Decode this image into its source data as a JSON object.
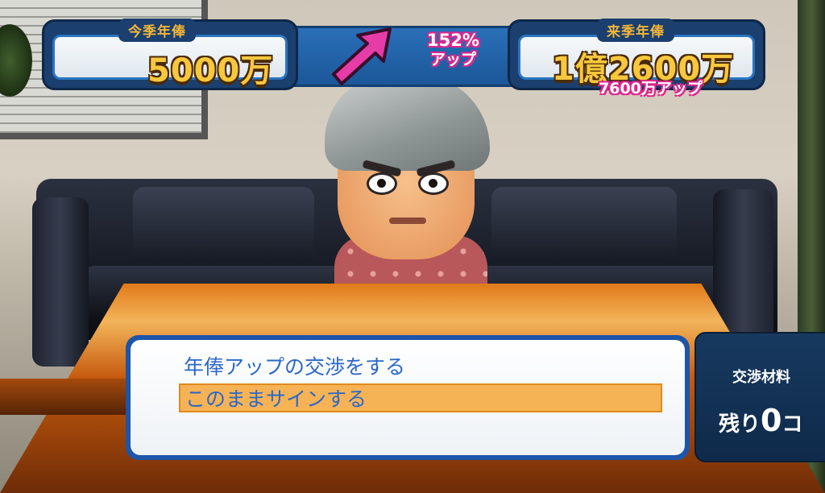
{
  "salary_header": {
    "current": {
      "label": "今季年俸",
      "amount": "5000万"
    },
    "change": {
      "percent": "152%",
      "word": "アップ"
    },
    "next": {
      "label": "来季年俸",
      "amount": "1億2600万",
      "raise": "7600万アップ"
    }
  },
  "dialog": {
    "options": [
      {
        "label": "年俸アップの交渉をする",
        "selected": false
      },
      {
        "label": "このままサインする",
        "selected": true
      }
    ]
  },
  "materials": {
    "title": "交渉材料",
    "prefix": "残り",
    "count": "0",
    "suffix": "コ"
  },
  "colors": {
    "panel_blue": "#1b3f6e",
    "gold_text": "#f7c73d",
    "pink_accent": "#e0258f",
    "option_text": "#2b67c8",
    "highlight": "#f6b355"
  },
  "icons": [
    "up-arrow-icon"
  ]
}
